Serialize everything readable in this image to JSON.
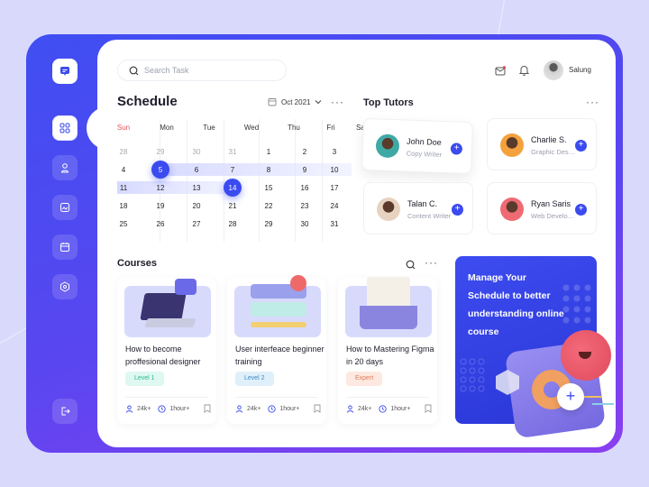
{
  "sidebar": {
    "items": [
      {
        "name": "messages",
        "icon": "chat-icon"
      },
      {
        "name": "dashboard",
        "icon": "grid-icon",
        "active": true
      },
      {
        "name": "profile",
        "icon": "user-icon"
      },
      {
        "name": "gallery",
        "icon": "image-icon"
      },
      {
        "name": "calendar",
        "icon": "calendar-icon"
      },
      {
        "name": "settings",
        "icon": "hexagon-icon"
      },
      {
        "name": "logout",
        "icon": "logout-icon"
      }
    ]
  },
  "header": {
    "search_placeholder": "Search Task",
    "user_name": "Salung"
  },
  "schedule": {
    "title": "Schedule",
    "month": "Oct 2021",
    "weekdays": [
      "Sun",
      "Mon",
      "Tue",
      "Wed",
      "Thu",
      "Fri",
      "Sat"
    ],
    "weeks": [
      [
        "28",
        "29",
        "30",
        "31",
        "1",
        "2",
        "3"
      ],
      [
        "4",
        "5",
        "6",
        "7",
        "8",
        "9",
        "10"
      ],
      [
        "11",
        "12",
        "13",
        "14",
        "15",
        "16",
        "17"
      ],
      [
        "18",
        "19",
        "20",
        "21",
        "22",
        "23",
        "24"
      ],
      [
        "25",
        "26",
        "27",
        "28",
        "29",
        "30",
        "31"
      ]
    ],
    "selected": [
      "5",
      "14"
    ]
  },
  "tutors": {
    "title": "Top Tutors",
    "items": [
      {
        "name": "John Doe",
        "role": "Copy Writer",
        "color": "#3fa9a6"
      },
      {
        "name": "Charlie S.",
        "role": "Graphic Designer",
        "color": "#f4a23d"
      },
      {
        "name": "Talan C.",
        "role": "Content Writer",
        "color": "#e8d3c0"
      },
      {
        "name": "Ryan Saris",
        "role": "Web Developer",
        "color": "#ef6a72"
      }
    ]
  },
  "courses": {
    "title": "Courses",
    "items": [
      {
        "title": "How to become proffesional designer",
        "level": "Level 1",
        "level_bg": "#dff8f1",
        "level_fg": "#2eb88a",
        "students": "24k+",
        "duration": "1hour+"
      },
      {
        "title": "User interfeace beginner training",
        "level": "Level 2",
        "level_bg": "#e0f0fb",
        "level_fg": "#3a8ac9",
        "students": "24k+",
        "duration": "1hour+"
      },
      {
        "title": "How to Mastering Figma in 20 days",
        "level": "Expert",
        "level_bg": "#fde9e0",
        "level_fg": "#e07a55",
        "students": "24k+",
        "duration": "1hour+"
      }
    ]
  },
  "promo": {
    "text": "Manage Your Schedule to better understanding online course"
  },
  "colors": {
    "accent": "#3b4bf0",
    "sunday": "#e05555"
  }
}
